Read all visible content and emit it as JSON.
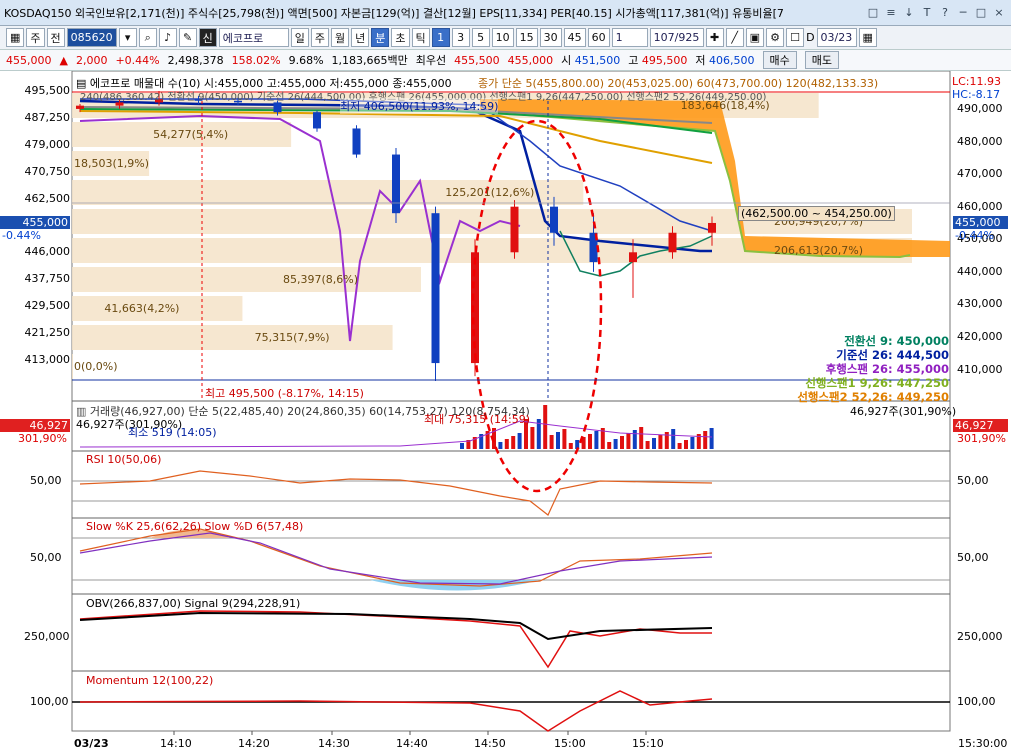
{
  "title": {
    "text": "KOSDAQ150 외국인보유[2,171(천)] 주식수[25,798(천)] 액면[500] 자본금[129(억)] 결산[12월] EPS[11,334] PER[40.15] 시가총액[117,381(억)] 유통비율[7",
    "controls": [
      "□",
      "≡",
      "↓",
      "T",
      "?",
      "─",
      "□",
      "×"
    ]
  },
  "toolbar": {
    "period_label": "주",
    "prev_label": "전",
    "code": "085620",
    "credit_label": "신",
    "stock_name": "에코프로",
    "buttons": [
      "일",
      "주",
      "월",
      "년",
      "분",
      "초",
      "틱"
    ],
    "minute_buttons": [
      "1",
      "3",
      "5",
      "10",
      "15",
      "30",
      "45",
      "60"
    ],
    "unit_value": "1",
    "page_count": "107/925",
    "date_value": "03/23",
    "d_label": "D"
  },
  "quote": {
    "price": "455,000",
    "change": "2,000",
    "change_pct": "+0.44%",
    "volume": "2,498,378",
    "vol_ratio": "158.02%",
    "turnover": "9.68%",
    "amount": "1,183,665백만",
    "best_bid_label": "최우선",
    "ask": "455,500",
    "bid": "455,000",
    "open_label": "시",
    "open": "451,500",
    "high_label": "고",
    "high": "495,500",
    "low_label": "저",
    "low": "406,500",
    "buy_label": "매수",
    "sell_label": "매도"
  },
  "colors": {
    "up": "#dd0000",
    "down": "#1040c0",
    "accent": "#3a6fc8"
  },
  "price_panel": {
    "header_left": "에코프로 매물대 수(10)  시:455,000 고:455,000 저:455,000 종:455,000",
    "header_ma": "종가 단순 5(455,800.00)   20(453,025.00)   60(473,700.00)   120(482,133.33)",
    "ichimoku_header": "240(486,360.42)  전환선 9(450,000)  기준선 26(444,500.00)  후행스팬 26(455,000.00)  선행스팬1 9,26(447,250.00)  선행스팬2 52,26(449,250.00)",
    "lc": "LC:11.93",
    "hc": "HC:-8.17",
    "current_price_tag": "455,000",
    "current_pct_tag": "-0.44%",
    "right_ticks": [
      "490,000",
      "480,000",
      "470,000",
      "460,000",
      "450,000",
      "440,000",
      "430,000",
      "420,000",
      "410,000"
    ],
    "left_ticks": [
      "495,500",
      "487,250",
      "479,000",
      "470,750",
      "462,500",
      "455,000",
      "446,000",
      "437,750",
      "429,500",
      "421,250",
      "413,000"
    ],
    "volume_profile": [
      {
        "label": "0(0,0%)"
      },
      {
        "label": "75,315(7,9%)"
      },
      {
        "label": "41,663(4,2%)"
      },
      {
        "label": "85,397(8,6%)"
      },
      {
        "label": "206,613(20,7%)"
      },
      {
        "label": "206,949(20,7%)"
      },
      {
        "label": "125,201(12,6%)"
      },
      {
        "label": "18,503(1,9%)"
      },
      {
        "label": "54,277(5,4%)"
      },
      {
        "label": "183,646(18,4%)"
      }
    ],
    "annotations": {
      "max_label": "최고 495,500 (-8.17%, 14:15)",
      "min_label": "최저 406,500(11.93%, 14:59)",
      "range_label": "(462,500.00 ~ 454,250.00)"
    },
    "ichimoku_legend": [
      {
        "label": "전환선 9: 450,000",
        "color": "#008060"
      },
      {
        "label": "기준선 26: 444,500",
        "color": "#0020a0"
      },
      {
        "label": "후행스팬 26: 455,000",
        "color": "#9020c0"
      },
      {
        "label": "선행스팬1 9,26: 447,250",
        "color": "#80b020"
      },
      {
        "label": "선행스팬2 52,26: 449,250",
        "color": "#e08000"
      }
    ]
  },
  "volume_panel": {
    "header": "거래량(46,927,00)  단순 5(22,485,40)  20(24,860,35)  60(14,753,27)  120(8,754,34)",
    "right_label": "46,927주(301,90%)",
    "left_tag": "46,927",
    "left_pct": "301,90%",
    "right_tag": "46,927",
    "right_pct": "301,90%",
    "vol_note": "46,927주(301,90%)",
    "min_note": "최소 519 (14:05)",
    "max_note": "최대 75,315 (14:59)"
  },
  "rsi_panel": {
    "header": "RSI 10(50,06)",
    "left_tick": "50,00",
    "right_tick": "50,00"
  },
  "stoch_panel": {
    "header": "Slow %K 25,6(62,26)  Slow %D 6(57,48)",
    "left_tick": "50,00",
    "right_tick": "50,00"
  },
  "obv_panel": {
    "header": "OBV(266,837,00)  Signal 9(294,228,91)",
    "left_tick": "250,000",
    "right_tick": "250,000"
  },
  "momentum_panel": {
    "header": "Momentum 12(100,22)",
    "left_tick": "100,00",
    "right_tick": "100,00"
  },
  "time_axis": {
    "date": "03/23",
    "ticks": [
      "14:10",
      "14:20",
      "14:30",
      "14:40",
      "14:50",
      "15:00",
      "15:10"
    ],
    "end_label": "15:30:00"
  },
  "chart_data": {
    "type": "candlestick",
    "x_label": "time",
    "price_range": [
      406500,
      495500
    ],
    "candles": [
      {
        "t": "14:05",
        "o": 490000,
        "h": 491500,
        "l": 489000,
        "c": 491000
      },
      {
        "t": "14:10",
        "o": 491000,
        "h": 493000,
        "l": 490000,
        "c": 492000
      },
      {
        "t": "14:15",
        "o": 492000,
        "h": 495500,
        "l": 491000,
        "c": 493000
      },
      {
        "t": "14:20",
        "o": 493000,
        "h": 494000,
        "l": 491500,
        "c": 492500
      },
      {
        "t": "14:30",
        "o": 492500,
        "h": 493500,
        "l": 491000,
        "c": 492000
      },
      {
        "t": "14:40",
        "o": 492000,
        "h": 492500,
        "l": 488000,
        "c": 489000
      },
      {
        "t": "14:45",
        "o": 489000,
        "h": 489500,
        "l": 483000,
        "c": 484000
      },
      {
        "t": "14:50",
        "o": 484000,
        "h": 485000,
        "l": 475000,
        "c": 476000
      },
      {
        "t": "14:55",
        "o": 476000,
        "h": 478000,
        "l": 455000,
        "c": 458000
      },
      {
        "t": "14:59",
        "o": 458000,
        "h": 460000,
        "l": 406500,
        "c": 412000
      },
      {
        "t": "15:00",
        "o": 412000,
        "h": 450000,
        "l": 408000,
        "c": 446000
      },
      {
        "t": "15:02",
        "o": 446000,
        "h": 462000,
        "l": 444000,
        "c": 460000
      },
      {
        "t": "15:05",
        "o": 460000,
        "h": 463000,
        "l": 448000,
        "c": 452000
      },
      {
        "t": "15:08",
        "o": 452000,
        "h": 458000,
        "l": 440000,
        "c": 443000
      },
      {
        "t": "15:10",
        "o": 443000,
        "h": 450000,
        "l": 432000,
        "c": 446000
      },
      {
        "t": "15:14",
        "o": 446000,
        "h": 454000,
        "l": 444000,
        "c": 452000
      },
      {
        "t": "15:18",
        "o": 452000,
        "h": 457000,
        "l": 448000,
        "c": 455000
      }
    ]
  }
}
